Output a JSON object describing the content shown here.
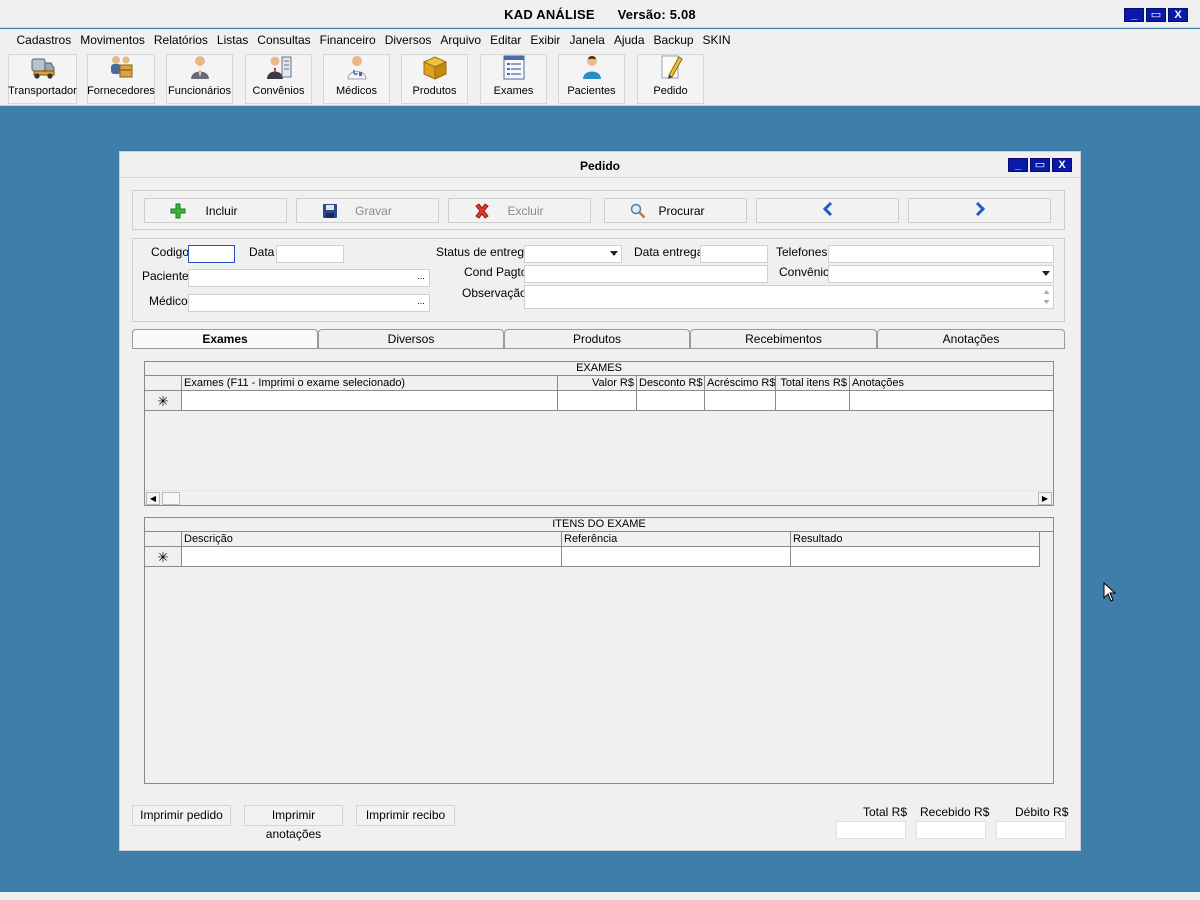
{
  "app": {
    "title": "KAD ANÁLISE      Versão: 5.08",
    "window_controls": [
      "_",
      "▭",
      "X"
    ]
  },
  "menu": [
    "Cadastros",
    "Movimentos",
    "Relatórios",
    "Listas",
    "Consultas",
    "Financeiro",
    "Diversos",
    "Arquivo",
    "Editar",
    "Exibir",
    "Janela",
    "Ajuda",
    "Backup",
    "SKIN"
  ],
  "toolbar": {
    "buttons": [
      {
        "label": "Transportador",
        "icon": "truck-icon"
      },
      {
        "label": "Fornecedores",
        "icon": "suppliers-icon"
      },
      {
        "label": "Funcionários",
        "icon": "employee-icon"
      },
      {
        "label": "Convênios",
        "icon": "agreement-icon"
      },
      {
        "label": "Médicos",
        "icon": "doctor-icon"
      },
      {
        "label": "Produtos",
        "icon": "box-icon"
      },
      {
        "label": "Exames",
        "icon": "list-icon"
      },
      {
        "label": "Pacientes",
        "icon": "patient-icon"
      },
      {
        "label": "Pedido",
        "icon": "pencil-icon"
      }
    ]
  },
  "pedido": {
    "title": "Pedido",
    "window_controls": [
      "_",
      "▭",
      "X"
    ],
    "actions": {
      "incluir": "Incluir",
      "gravar": "Gravar",
      "excluir": "Excluir",
      "procurar": "Procurar"
    },
    "form": {
      "codigo_label": "Codigo",
      "codigo_value": "",
      "data_label": "Data",
      "data_value": "",
      "paciente_label": "Paciente",
      "paciente_value": "",
      "medico_label": "Médico",
      "medico_value": "",
      "status_label": "Status de entrega",
      "status_value": "",
      "data_entrega_label": "Data entrega",
      "data_entrega_value": "",
      "telefones_label": "Telefones",
      "telefones_value": "",
      "cond_pagto_label": "Cond Pagto",
      "cond_pagto_value": "",
      "convenio_label": "Convênio",
      "convenio_value": "",
      "observacao_label": "Observação",
      "observacao_value": "",
      "dots": "..."
    },
    "tabs": [
      "Exames",
      "Diversos",
      "Produtos",
      "Recebimentos",
      "Anotações"
    ],
    "active_tab": "Exames",
    "exames_grid": {
      "caption": "EXAMES",
      "columns": [
        "Exames  (F11 - Imprimi o exame selecionado)",
        "Valor R$",
        "Desconto R$",
        "Acréscimo R$",
        "Total itens R$",
        "Anotações"
      ],
      "new_row_marker": "✳",
      "rows": []
    },
    "itens_grid": {
      "caption": "ITENS DO EXAME",
      "columns": [
        "Descrição",
        "Referência",
        "Resultado"
      ],
      "new_row_marker": "✳",
      "rows": []
    },
    "bottom_buttons": {
      "imprimir_pedido": "Imprimir pedido",
      "imprimir_anotacoes": "Imprimir anotações",
      "imprimir_recibo": "Imprimir recibo"
    },
    "totals": {
      "total_label": "Total R$",
      "total_value": "",
      "recebido_label": "Recebido R$",
      "recebido_value": "",
      "debito_label": "Débito R$",
      "debito_value": ""
    }
  },
  "colors": {
    "desktop": "#3f7ea8",
    "window_button": "#0a1aa8",
    "nav_arrow": "#1f5fc0"
  }
}
